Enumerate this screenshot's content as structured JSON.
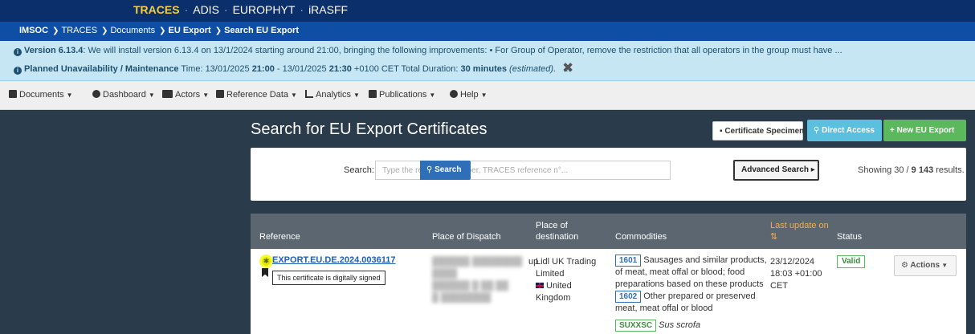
{
  "apps": {
    "active": "TRACES",
    "others": [
      "ADIS",
      "EUROPHYT",
      "iRASFF"
    ]
  },
  "breadcrumb": {
    "root": "IMSOC",
    "items": [
      "TRACES",
      "Documents",
      "EU Export",
      "Search EU Export"
    ]
  },
  "notice": {
    "version_label": "Version 6.13.4",
    "version_text": ": We will install version 6.13.4 on 13/1/2024 starting around 21:00, bringing the following improvements: •   For Group of Operator, remove the restriction that all operators in the group must have ...",
    "unavail_label": "Planned Unavailability / Maintenance",
    "unavail_time_prefix": " Time: 13/01/2025 ",
    "unavail_start": "21:00",
    "unavail_mid": " - 13/01/2025 ",
    "unavail_end": "21:30",
    "unavail_tz": " +0100 CET Total Duration: ",
    "duration": "30 minutes",
    "estimated": "(estimated).",
    "more": "...",
    "close": "✖"
  },
  "menu": [
    "Documents",
    "Dashboard",
    "Actors",
    "Reference Data",
    "Analytics",
    "Publications",
    "Help"
  ],
  "page": {
    "title": "Search for EU Export Certificates"
  },
  "buttons": {
    "specimen": "Certificate Specimen",
    "direct": "Direct Access",
    "new": "+ New EU Export",
    "search": "Search",
    "advanced": "Advanced Search ▸",
    "actions": "Actions"
  },
  "search": {
    "label": "Search:",
    "placeholder": "Type the reference number, TRACES reference n°..."
  },
  "results": {
    "prefix": "Showing 30 / ",
    "total": "9 143",
    "suffix": " results."
  },
  "table": {
    "headers": {
      "reference": "Reference",
      "dispatch": "Place of Dispatch",
      "destination_1": "Place of",
      "destination_2": "destination",
      "commodities": "Commodities",
      "last_update_1": "Last update on",
      "last_update_icon": "⇅",
      "status": "Status"
    },
    "rows": [
      {
        "reference": "EXPORT.EU.DE.2024.0036117",
        "tooltip": "This certificate is digitally signed",
        "dispatch_tail": "up",
        "destination_1": "Lidl UK Trading",
        "destination_2": "Limited",
        "destination_3": "United",
        "destination_4": "Kingdom",
        "commodities": [
          {
            "code": "1601",
            "text_1": "Sausages and similar products,",
            "text_2": "of meat, meat offal or blood; food",
            "text_3": "preparations based on these products"
          },
          {
            "code": "1602",
            "text_1": "Other prepared or preserved",
            "text_2": "meat, meat offal or blood"
          }
        ],
        "species_code": "SUXXSC",
        "species_name": "Sus scrofa",
        "date": "23/12/2024",
        "time": "18:03 +01:00",
        "tz": "CET",
        "status": "Valid"
      }
    ]
  }
}
